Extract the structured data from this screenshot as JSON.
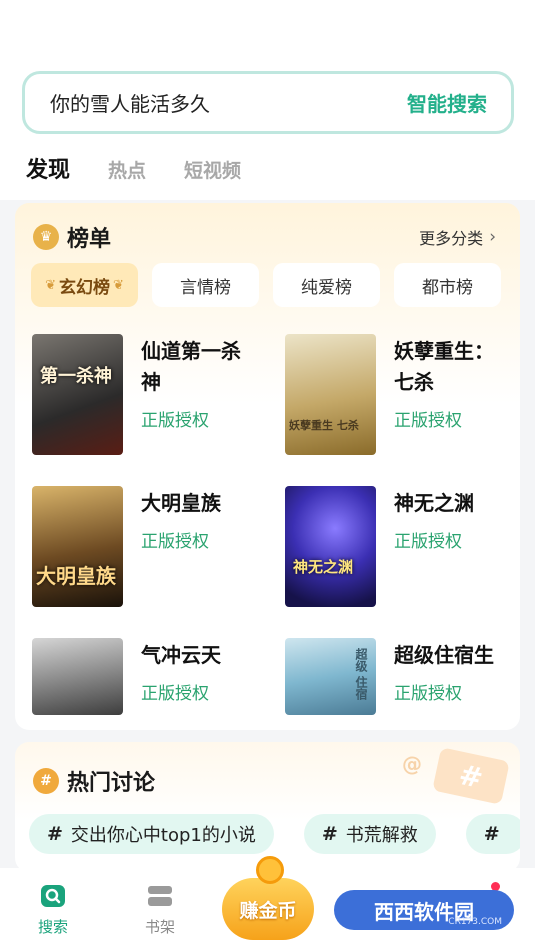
{
  "search": {
    "query": "你的雪人能活多久",
    "action_label": "智能搜索"
  },
  "nav_tabs": [
    {
      "label": "发现",
      "active": true
    },
    {
      "label": "热点",
      "active": false
    },
    {
      "label": "短视频",
      "active": false
    }
  ],
  "rankings": {
    "title": "榜单",
    "icon": "trophy-icon",
    "more_label": "更多分类",
    "tabs": [
      {
        "label": "玄幻榜",
        "active": true
      },
      {
        "label": "言情榜",
        "active": false
      },
      {
        "label": "纯爱榜",
        "active": false
      },
      {
        "label": "都市榜",
        "active": false
      }
    ],
    "books": [
      {
        "title": "仙道第一杀神",
        "tag": "正版授权",
        "cover_text": "第一杀神",
        "cover_color": "#3b3a3a"
      },
      {
        "title": "妖孽重生：七杀",
        "tag": "正版授权",
        "cover_text": "妖孽重生 七杀",
        "cover_color": "#c9b58a"
      },
      {
        "title": "大明皇族",
        "tag": "正版授权",
        "cover_text": "大明皇族",
        "cover_color": "#5a3b1e"
      },
      {
        "title": "神无之渊",
        "tag": "正版授权",
        "cover_text": "神无之渊",
        "cover_color": "#2b2b8a"
      },
      {
        "title": "气冲云天",
        "tag": "正版授权",
        "cover_text": "",
        "cover_color": "#6b6b6b"
      },
      {
        "title": "超级住宿生",
        "tag": "正版授权",
        "cover_text": "超级 住宿",
        "cover_color": "#7fb7cf"
      }
    ]
  },
  "discussion": {
    "title": "热门讨论",
    "topics": [
      {
        "label": "交出你心中top1的小说"
      },
      {
        "label": "书荒解救"
      }
    ]
  },
  "bottom_nav": {
    "items": [
      {
        "label": "搜索",
        "icon": "search-tab-icon",
        "active": true
      },
      {
        "label": "书架",
        "icon": "bookshelf-icon",
        "active": false
      }
    ],
    "earn_label": "赚金币",
    "watermark": "西西软件园",
    "watermark_sub": "CR173.COM"
  },
  "colors": {
    "accent": "#23b08b",
    "tag_green": "#2aa36f",
    "gold": "#e8b24a"
  }
}
